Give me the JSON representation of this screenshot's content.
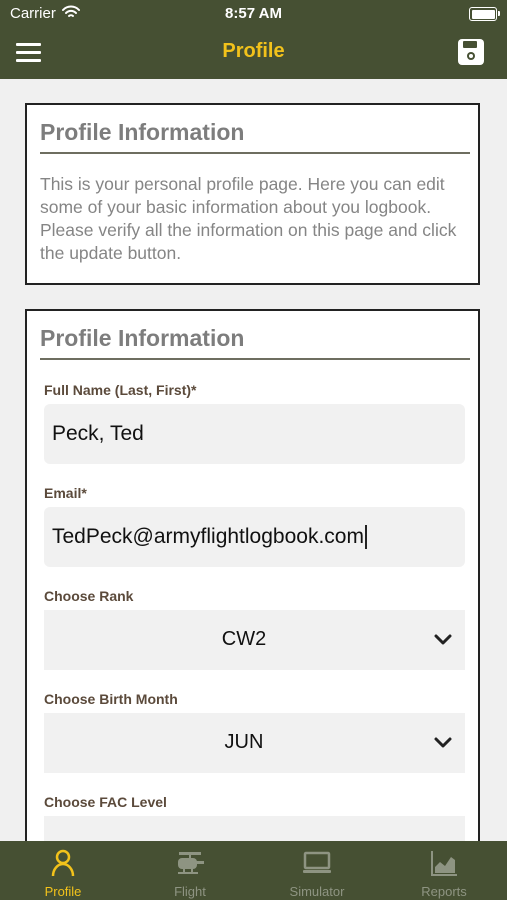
{
  "status_bar": {
    "carrier": "Carrier",
    "time": "8:57 AM"
  },
  "header": {
    "title": "Profile",
    "menu_icon": "hamburger-icon",
    "save_icon": "save-icon"
  },
  "info_card": {
    "title": "Profile Information",
    "body": "This is your personal profile page. Here you can edit some of your basic information about you logbook. Please verify all the information on this page and click the update button."
  },
  "form_card": {
    "title": "Profile Information",
    "full_name": {
      "label": "Full Name (Last, First)*",
      "value": "Peck, Ted"
    },
    "email": {
      "label": "Email*",
      "value": "TedPeck@armyflightlogbook.com"
    },
    "rank": {
      "label": "Choose Rank",
      "value": "CW2"
    },
    "birth_month": {
      "label": "Choose Birth Month",
      "value": "JUN"
    },
    "fac_level": {
      "label": "Choose FAC Level"
    }
  },
  "tabs": [
    {
      "label": "Profile",
      "icon": "person-icon",
      "active": true
    },
    {
      "label": "Flight",
      "icon": "helicopter-icon",
      "active": false
    },
    {
      "label": "Simulator",
      "icon": "monitor-icon",
      "active": false
    },
    {
      "label": "Reports",
      "icon": "chart-icon",
      "active": false
    }
  ],
  "colors": {
    "header_bg": "#465033",
    "accent": "#f2c21b",
    "tab_inactive": "#8e9482"
  }
}
